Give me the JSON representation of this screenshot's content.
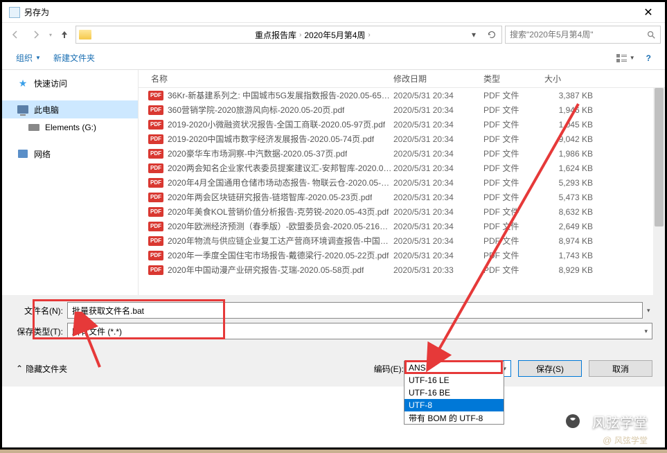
{
  "titlebar": {
    "title": "另存为"
  },
  "breadcrumb": {
    "items": [
      "重点报告库",
      "2020年5月第4周"
    ]
  },
  "search": {
    "placeholder": "搜索\"2020年5月第4周\""
  },
  "toolbar": {
    "organize": "组织",
    "new_folder": "新建文件夹"
  },
  "columns": {
    "name": "名称",
    "date": "修改日期",
    "type": "类型",
    "size": "大小"
  },
  "sidebar": {
    "quick_access": "快速访问",
    "this_pc": "此电脑",
    "drive_g": "Elements (G:)",
    "network": "网络"
  },
  "files": [
    {
      "name": "36Kr-新基建系列之: 中国城市5G发展指数报告-2020.05-65页....",
      "date": "2020/5/31 20:34",
      "type": "PDF 文件",
      "size": "3,387 KB"
    },
    {
      "name": "360营销学院-2020旅游风向标-2020.05-20页.pdf",
      "date": "2020/5/31 20:34",
      "type": "PDF 文件",
      "size": "1,946 KB"
    },
    {
      "name": "2019-2020小微融资状况报告-全国工商联-2020.05-97页.pdf",
      "date": "2020/5/31 20:34",
      "type": "PDF 文件",
      "size": "1,045 KB"
    },
    {
      "name": "2019-2020中国城市数字经济发展报告-2020.05-74页.pdf",
      "date": "2020/5/31 20:34",
      "type": "PDF 文件",
      "size": "9,042 KB"
    },
    {
      "name": "2020豪华车市场洞察-中汽数据-2020.05-37页.pdf",
      "date": "2020/5/31 20:34",
      "type": "PDF 文件",
      "size": "1,986 KB"
    },
    {
      "name": "2020两会知名企业家代表委员提案建议汇-安邦智库-2020.05-9...",
      "date": "2020/5/31 20:34",
      "type": "PDF 文件",
      "size": "1,624 KB"
    },
    {
      "name": "2020年4月全国通用仓储市场动态报告- 物联云仓-2020.05-12...",
      "date": "2020/5/31 20:34",
      "type": "PDF 文件",
      "size": "5,293 KB"
    },
    {
      "name": "2020年两会区块链研究报告-链塔智库-2020.05-23页.pdf",
      "date": "2020/5/31 20:34",
      "type": "PDF 文件",
      "size": "5,473 KB"
    },
    {
      "name": "2020年美食KOL营销价值分析报告-克劳锐-2020.05-43页.pdf",
      "date": "2020/5/31 20:34",
      "type": "PDF 文件",
      "size": "8,632 KB"
    },
    {
      "name": "2020年欧洲经济预测（春季版）-欧盟委员会-2020.05-216页.p...",
      "date": "2020/5/31 20:34",
      "type": "PDF 文件",
      "size": "2,649 KB"
    },
    {
      "name": "2020年物流与供应链企业复工达产营商环境调查报告-中国物流...",
      "date": "2020/5/31 20:34",
      "type": "PDF 文件",
      "size": "8,974 KB"
    },
    {
      "name": "2020年一季度全国住宅市场报告-戴德梁行-2020.05-22页.pdf",
      "date": "2020/5/31 20:34",
      "type": "PDF 文件",
      "size": "1,743 KB"
    },
    {
      "name": "2020年中国动漫产业研究报告-艾瑞-2020.05-58页.pdf",
      "date": "2020/5/31 20:33",
      "type": "PDF 文件",
      "size": "8,929 KB"
    }
  ],
  "inputs": {
    "filename_label": "文件名(N):",
    "filename_value": "批量获取文件名.bat",
    "filetype_label": "保存类型(T):",
    "filetype_value": "所有文件  (*.*)"
  },
  "actions": {
    "hide_folders": "隐藏文件夹",
    "encoding_label": "编码(E):",
    "encoding_value": "UTF-8",
    "save": "保存(S)",
    "cancel": "取消"
  },
  "encoding_options": [
    "ANSI",
    "UTF-16 LE",
    "UTF-16 BE",
    "UTF-8",
    "带有 BOM 的 UTF-8"
  ],
  "watermark": {
    "text": "风弦学堂",
    "sub": "风弦学堂"
  }
}
